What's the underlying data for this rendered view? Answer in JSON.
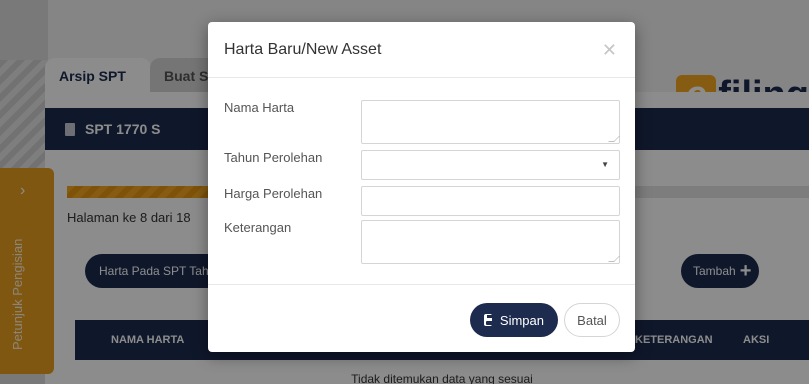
{
  "tabs": [
    {
      "label": "Arsip SPT"
    },
    {
      "label": "Buat S"
    }
  ],
  "logo": {
    "text": "filing",
    "mark": "e"
  },
  "spt_bar": {
    "label": "SPT 1770 S"
  },
  "progress": {
    "fraction": 0.44
  },
  "pagination": {
    "text": "Halaman ke 8 dari 18"
  },
  "buttons": {
    "harta_label": "Harta Pada SPT Tah",
    "tambah_label": "Tambah"
  },
  "table": {
    "headers": {
      "nama": "NAMA HARTA",
      "keterangan": "KETERANGAN",
      "aksi": "AKSI"
    },
    "empty": "Tidak ditemukan data yang sesuai"
  },
  "side_tab": {
    "label": "Petunjuk Pengisian"
  },
  "modal": {
    "title": "Harta Baru/New Asset",
    "fields": {
      "nama": {
        "label": "Nama Harta",
        "value": ""
      },
      "tahun": {
        "label": "Tahun Perolehan",
        "value": ""
      },
      "harga": {
        "label": "Harga Perolehan",
        "value": ""
      },
      "keterangan": {
        "label": "Keterangan",
        "value": ""
      }
    },
    "save_label": "Simpan",
    "cancel_label": "Batal"
  },
  "colors": {
    "navy": "#1d2b4f",
    "accent": "#f4a821"
  }
}
